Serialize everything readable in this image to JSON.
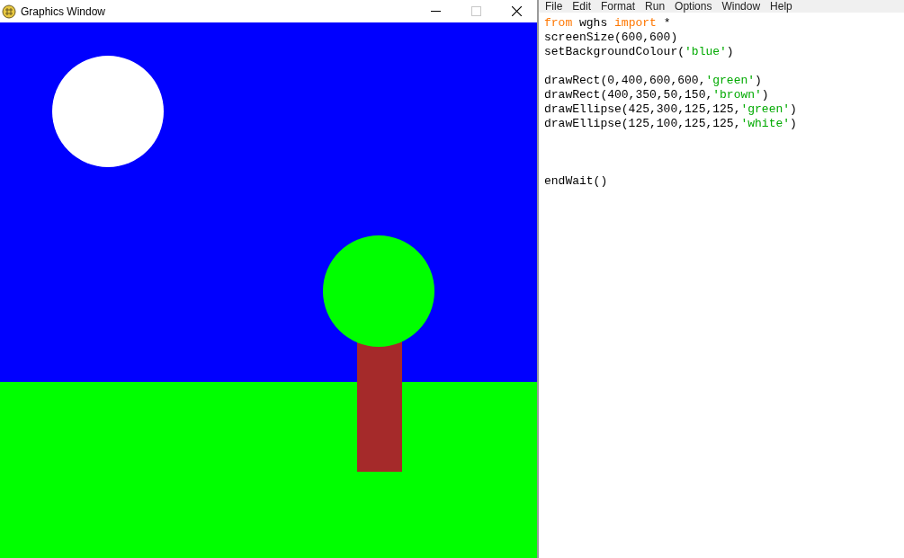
{
  "graphics_window": {
    "title": "Graphics Window",
    "buttons": [
      {
        "kind": "minimize",
        "disabled": false
      },
      {
        "kind": "maximize",
        "disabled": true
      },
      {
        "kind": "close",
        "disabled": false
      }
    ]
  },
  "editor": {
    "menu": [
      "File",
      "Edit",
      "Format",
      "Run",
      "Options",
      "Window",
      "Help"
    ],
    "lines": [
      {
        "kind": "code",
        "tokens": [
          {
            "kind": "keyword",
            "text": "from"
          },
          {
            "kind": "plain",
            "text": " wghs "
          },
          {
            "kind": "keyword",
            "text": "import"
          },
          {
            "kind": "plain",
            "text": " *"
          }
        ]
      },
      {
        "kind": "code",
        "tokens": [
          {
            "kind": "plain",
            "text": "screenSize(600,600)"
          }
        ]
      },
      {
        "kind": "code",
        "tokens": [
          {
            "kind": "plain",
            "text": "setBackgroundColour("
          },
          {
            "kind": "string",
            "text": "'blue'"
          },
          {
            "kind": "plain",
            "text": ")"
          }
        ]
      },
      {
        "kind": "blank"
      },
      {
        "kind": "code",
        "tokens": [
          {
            "kind": "plain",
            "text": "drawRect(0,400,600,600,"
          },
          {
            "kind": "string",
            "text": "'green'"
          },
          {
            "kind": "plain",
            "text": ")"
          }
        ]
      },
      {
        "kind": "code",
        "tokens": [
          {
            "kind": "plain",
            "text": "drawRect(400,350,50,150,"
          },
          {
            "kind": "string",
            "text": "'brown'"
          },
          {
            "kind": "plain",
            "text": ")"
          }
        ]
      },
      {
        "kind": "code",
        "tokens": [
          {
            "kind": "plain",
            "text": "drawEllipse(425,300,125,125,"
          },
          {
            "kind": "string",
            "text": "'green'"
          },
          {
            "kind": "plain",
            "text": ")"
          }
        ]
      },
      {
        "kind": "code",
        "tokens": [
          {
            "kind": "plain",
            "text": "drawEllipse(125,100,125,125,"
          },
          {
            "kind": "string",
            "text": "'white'"
          },
          {
            "kind": "plain",
            "text": ")"
          }
        ]
      },
      {
        "kind": "blank"
      },
      {
        "kind": "blank"
      },
      {
        "kind": "blank"
      },
      {
        "kind": "code",
        "tokens": [
          {
            "kind": "plain",
            "text": "endWait()"
          }
        ]
      }
    ]
  }
}
